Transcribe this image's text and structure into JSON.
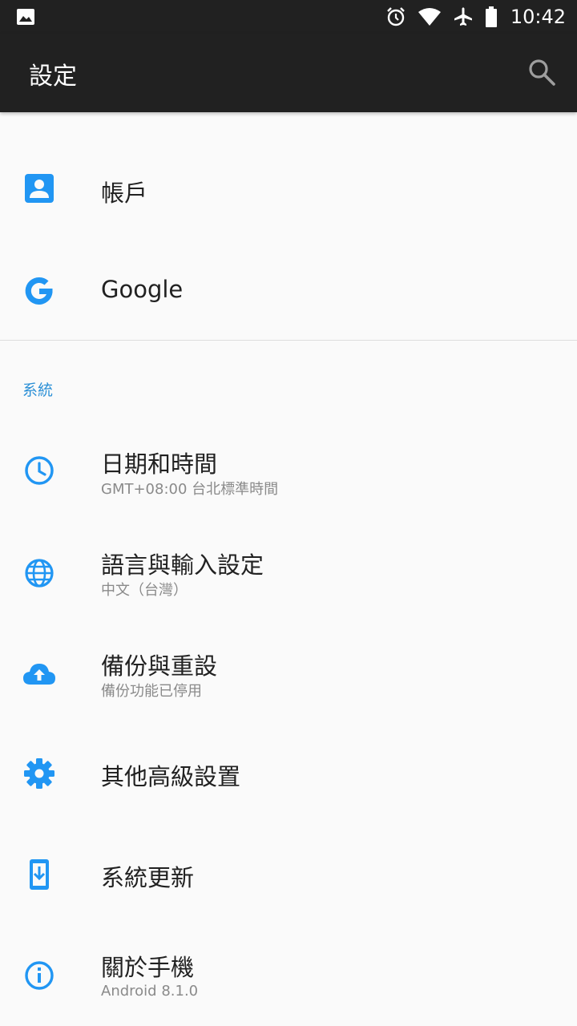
{
  "status_bar": {
    "time": "10:42",
    "icons": [
      "image-icon",
      "alarm-icon",
      "wifi-icon",
      "airplane-icon",
      "battery-icon"
    ]
  },
  "toolbar": {
    "title": "設定",
    "search_icon": "search-icon"
  },
  "accent_color": "#2196f3",
  "items_top": [
    {
      "title": "帳戶",
      "icon": "account-icon"
    },
    {
      "title": "Google",
      "icon": "google-icon"
    }
  ],
  "section": {
    "header": "系統"
  },
  "items_system": [
    {
      "title": "日期和時間",
      "summary": "GMT+08:00 台北標準時間",
      "icon": "clock-icon"
    },
    {
      "title": "語言與輸入設定",
      "summary": "中文（台灣）",
      "icon": "globe-icon"
    },
    {
      "title": "備份與重設",
      "summary": "備份功能已停用",
      "icon": "cloud-upload-icon"
    },
    {
      "title": "其他高級設置",
      "icon": "gear-icon"
    },
    {
      "title": "系統更新",
      "icon": "system-update-icon"
    },
    {
      "title": "關於手機",
      "summary": "Android 8.1.0",
      "icon": "info-icon"
    }
  ]
}
